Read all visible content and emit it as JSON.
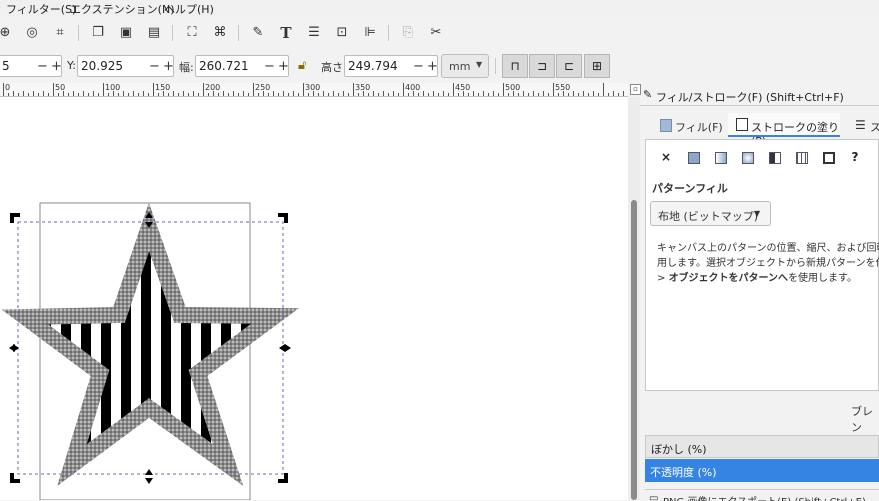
{
  "menubar": {
    "items": [
      "フィルター(S)",
      "エクステンション(N)",
      "ヘルプ(H)"
    ]
  },
  "toolbar1": {
    "icons": [
      "zoom-drawing-icon",
      "zoom-page-icon",
      "zoom-fit-icon",
      "duplicate-icon",
      "clone-icon",
      "unlink-clone-icon",
      "group-icon",
      "ungroup-icon",
      "fill-stroke-icon",
      "text-icon",
      "layers-icon",
      "xml-editor-icon",
      "align-icon",
      "preferences-icon",
      "document-properties-icon"
    ]
  },
  "toolbar2": {
    "x_value": "5",
    "y_label": "Y:",
    "y_value": "20.925",
    "w_label": "幅:",
    "w_value": "260.721",
    "h_label": "高さ:",
    "h_value": "249.794",
    "unit": "mm",
    "minus": "−",
    "plus": "+"
  },
  "ruler": {
    "labels": [
      "0",
      "50",
      "100",
      "150",
      "200",
      "250",
      "300",
      "350",
      "400",
      "450",
      "500",
      "550"
    ]
  },
  "panel": {
    "title": "フィル/ストローク(F) (Shift+Ctrl+F)",
    "tabs": [
      "フィル(F)",
      "ストロークの塗り(P)",
      "ス"
    ],
    "fill_type_none": "×",
    "fill_type_unset": "?",
    "section_title": "パターンフィル",
    "pattern_select": "布地 (ビットマップ)",
    "help_line1": "キャンバス上のパターンの位置、縮尺、および回転を",
    "help_line2": "用します。選択オブジェクトから新規パターンを作成す",
    "help_line3_prefix": "> ",
    "help_line3_bold": "オブジェクトをパターンへ",
    "help_line3_suffix": "を使用します。",
    "blend_label": "ブレン",
    "blur_label": "ぼかし (%)",
    "opacity_label": "不透明度 (%)",
    "export_label": "PNG 画像にエクスポート(E) (Shift+Ctrl+E)"
  },
  "colors": {
    "accent": "#3584e4",
    "selection": "#4a90d9"
  }
}
